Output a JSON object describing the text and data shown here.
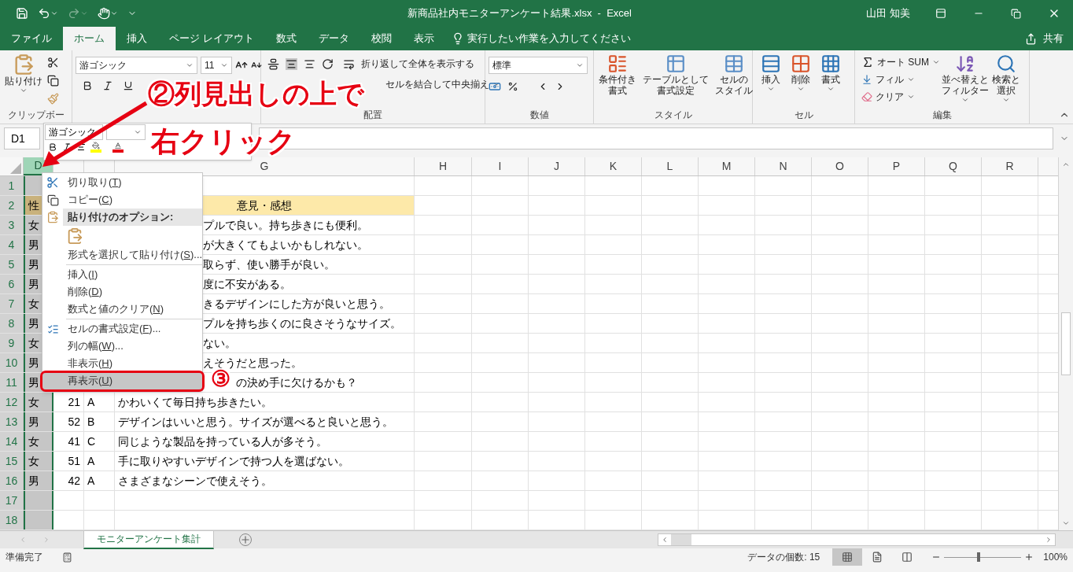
{
  "title_bar": {
    "title": "新商品社内モニターアンケート結果.xlsx  -  Excel",
    "user": "山田 知美",
    "redo_disabled": true
  },
  "tabs": [
    {
      "label": "ファイル",
      "selected": false
    },
    {
      "label": "ホーム",
      "selected": true
    },
    {
      "label": "挿入",
      "selected": false
    },
    {
      "label": "ページ レイアウト",
      "selected": false
    },
    {
      "label": "数式",
      "selected": false
    },
    {
      "label": "データ",
      "selected": false
    },
    {
      "label": "校閲",
      "selected": false
    },
    {
      "label": "表示",
      "selected": false
    }
  ],
  "tell_me": {
    "placeholder": "実行したい作業を入力してください"
  },
  "share": "共有",
  "ribbon": {
    "clipboard": {
      "paste": "貼り付け",
      "label": "クリップボー"
    },
    "font": {
      "name": "游ゴシック",
      "size": "11"
    },
    "alignment": {
      "wrap": "折り返して全体を表示する",
      "merge": "セルを結合して中央揃え",
      "label": "配置"
    },
    "number": {
      "format": "標準",
      "label": "数値"
    },
    "styles": {
      "buttons": [
        {
          "lines": [
            "条件付き",
            "書式"
          ]
        },
        {
          "lines": [
            "テーブルとして",
            "書式設定"
          ]
        },
        {
          "lines": [
            "セルの",
            "スタイル"
          ]
        }
      ],
      "label": "スタイル"
    },
    "cells": {
      "buttons": [
        "挿入",
        "削除",
        "書式"
      ],
      "label": "セル"
    },
    "editing": {
      "autosum": "オート SUM",
      "fill": "フィル",
      "clear": "クリア",
      "buttons": [
        {
          "lines": [
            "並べ替えと",
            "フィルター"
          ]
        },
        {
          "lines": [
            "検索と",
            "選択"
          ]
        }
      ],
      "label": "編集"
    }
  },
  "name_box": "D1",
  "mini_toolbar": {
    "font": "游ゴシック"
  },
  "columns": [
    {
      "label": "D",
      "selected": true
    },
    {
      "selected": false
    },
    {
      "selected": false
    },
    {
      "label": "G",
      "selected": false
    },
    {
      "label": "H",
      "selected": false
    },
    {
      "label": "I",
      "selected": false
    },
    {
      "label": "J",
      "selected": false
    },
    {
      "label": "K",
      "selected": false
    },
    {
      "label": "L",
      "selected": false
    },
    {
      "label": "M",
      "selected": false
    },
    {
      "label": "N",
      "selected": false
    },
    {
      "label": "O",
      "selected": false
    },
    {
      "label": "P",
      "selected": false
    },
    {
      "label": "Q",
      "selected": false
    },
    {
      "label": "R",
      "selected": false
    }
  ],
  "rows": [
    {
      "num": "1",
      "kind": "blank"
    },
    {
      "num": "2",
      "kind": "header",
      "d": "性",
      "g": "意見・感想"
    },
    {
      "num": "3",
      "kind": "covered",
      "d": "女",
      "g": "プルで良い。持ち歩きにも便利。"
    },
    {
      "num": "4",
      "kind": "covered",
      "d": "男",
      "g": "が大きくてもよいかもしれない。"
    },
    {
      "num": "5",
      "kind": "covered",
      "d": "男",
      "g": "取らず、使い勝手が良い。"
    },
    {
      "num": "6",
      "kind": "covered",
      "d": "男",
      "g": "度に不安がある。"
    },
    {
      "num": "7",
      "kind": "covered",
      "d": "女",
      "g": "きるデザインにした方が良いと思う。"
    },
    {
      "num": "8",
      "kind": "covered",
      "d": "男",
      "g": "プルを持ち歩くのに良さそうなサイズ。"
    },
    {
      "num": "9",
      "kind": "covered",
      "d": "女",
      "g": "ない。"
    },
    {
      "num": "10",
      "kind": "covered",
      "d": "男",
      "g": "えそうだと思った。"
    },
    {
      "num": "11",
      "kind": "badge_covered",
      "d": "男",
      "g": "の決め手に欠けるかも？"
    },
    {
      "num": "12",
      "kind": "full",
      "d": "女",
      "e": "21",
      "f": "A",
      "g": "かわいくて毎日持ち歩きたい。"
    },
    {
      "num": "13",
      "kind": "full",
      "d": "男",
      "e": "52",
      "f": "B",
      "g": "デザインはいいと思う。サイズが選べると良いと思う。"
    },
    {
      "num": "14",
      "kind": "full",
      "d": "女",
      "e": "41",
      "f": "C",
      "g": "同じような製品を持っている人が多そう。"
    },
    {
      "num": "15",
      "kind": "full",
      "d": "女",
      "e": "51",
      "f": "A",
      "g": "手に取りやすいデザインで持つ人を選ばない。"
    },
    {
      "num": "16",
      "kind": "full",
      "d": "男",
      "e": "42",
      "f": "A",
      "g": "さまざまなシーンで使えそう。"
    },
    {
      "num": "17",
      "kind": "blank"
    },
    {
      "num": "18",
      "kind": "blank"
    }
  ],
  "context_menu": [
    {
      "kind": "cut",
      "before": "切り取り(",
      "accel": "T",
      "after": ")",
      "selected": false
    },
    {
      "kind": "copy",
      "before": "コピー(",
      "accel": "C",
      "after": ")",
      "selected": false
    },
    {
      "kind": "paste_header",
      "before": "貼り付けのオプション:"
    },
    {
      "kind": "paste_options"
    },
    {
      "kind": "plain",
      "before": "形式を選択して貼り付け(",
      "accel": "S",
      "after": ")...",
      "selected": false
    },
    {
      "kind": "separator"
    },
    {
      "kind": "plain",
      "before": "挿入(",
      "accel": "I",
      "after": ")",
      "selected": false
    },
    {
      "kind": "plain",
      "before": "削除(",
      "accel": "D",
      "after": ")",
      "selected": false
    },
    {
      "kind": "plain",
      "before": "数式と値のクリア(",
      "accel": "N",
      "after": ")",
      "selected": false
    },
    {
      "kind": "separator"
    },
    {
      "kind": "format",
      "before": "セルの書式設定(",
      "accel": "F",
      "after": ")...",
      "selected": false
    },
    {
      "kind": "plain",
      "before": "列の幅(",
      "accel": "W",
      "after": ")...",
      "selected": false
    },
    {
      "kind": "plain",
      "before": "非表示(",
      "accel": "H",
      "after": ")",
      "selected": false
    },
    {
      "kind": "plain",
      "before": "再表示(",
      "accel": "U",
      "after": ")",
      "selected": true
    }
  ],
  "annotations": {
    "step2_line1": "②列見出しの上で",
    "step2_line2": "右クリック",
    "step3": "③"
  },
  "sheet_tabs": [
    {
      "label": "モニターアンケート集計",
      "selected": true
    }
  ],
  "status_bar": {
    "ready": "準備完了",
    "count": "データの個数: 15",
    "views": [
      {
        "kind": "normal",
        "selected": true
      },
      {
        "kind": "page_layout",
        "selected": false
      },
      {
        "kind": "page_break",
        "selected": false
      }
    ],
    "zoom": {
      "level": 0.45,
      "reading": "100%"
    }
  }
}
